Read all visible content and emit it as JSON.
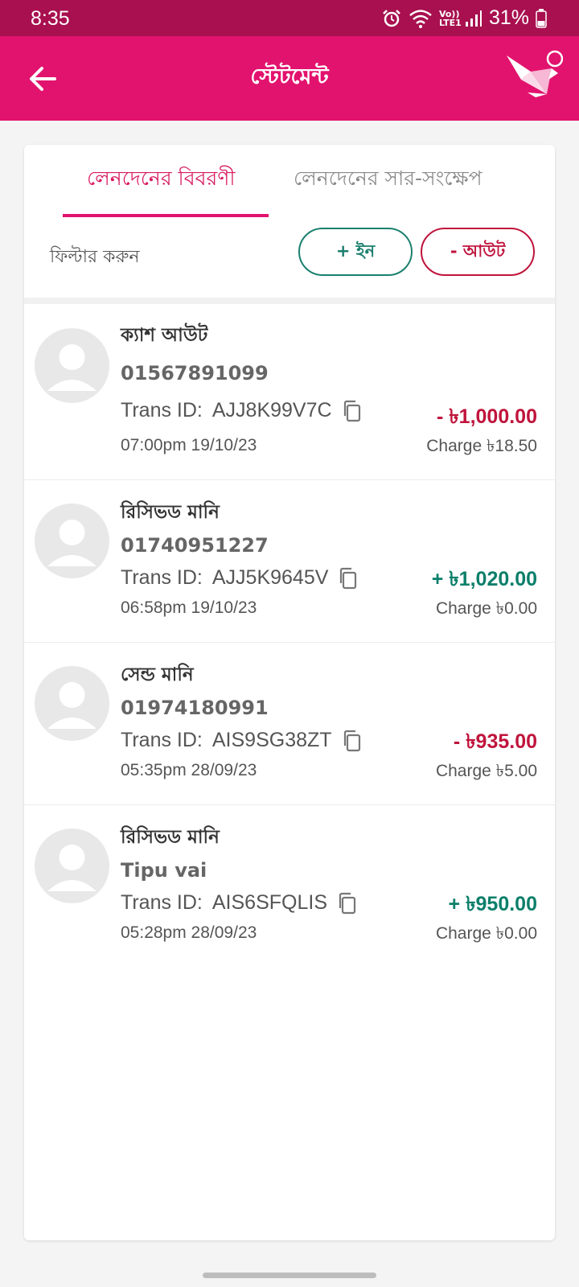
{
  "status_bar": {
    "time": "8:35",
    "network": "Vo)) LTE1",
    "battery": "31%"
  },
  "app_bar": {
    "title": "স্টেটমেন্ট"
  },
  "tabs": [
    {
      "label": "লেনদেনের বিবরণী",
      "active": true
    },
    {
      "label": "লেনদেনের সার-সংক্ষেপ",
      "active": false
    }
  ],
  "filter": {
    "label": "ফিল্টার করুন",
    "in_label": "+  ইন",
    "out_label": "-  আউট"
  },
  "transactions": [
    {
      "type": "ক্যাশ আউট",
      "party": "01567891099",
      "trans_id_label": "Trans ID:",
      "trans_id": "AJJ8K99V7C",
      "time": "07:00pm 19/10/23",
      "amount": "- ৳1,000.00",
      "direction": "out",
      "charge": "Charge ৳18.50"
    },
    {
      "type": "রিসিভড মানি",
      "party": "01740951227",
      "trans_id_label": "Trans ID:",
      "trans_id": "AJJ5K9645V",
      "time": "06:58pm 19/10/23",
      "amount": "+ ৳1,020.00",
      "direction": "in",
      "charge": "Charge ৳0.00"
    },
    {
      "type": "সেন্ড মানি",
      "party": "01974180991",
      "trans_id_label": "Trans ID:",
      "trans_id": "AIS9SG38ZT",
      "time": "05:35pm 28/09/23",
      "amount": "- ৳935.00",
      "direction": "out",
      "charge": "Charge ৳5.00"
    },
    {
      "type": "রিসিভড মানি",
      "party": "Tipu vai",
      "trans_id_label": "Trans ID:",
      "trans_id": "AIS6SFQLIS",
      "time": "05:28pm 28/09/23",
      "amount": "+ ৳950.00",
      "direction": "in",
      "charge": "Charge ৳0.00"
    }
  ],
  "colors": {
    "brand": "#e2136e",
    "status_bar": "#a8104f",
    "out": "#c0143c",
    "in": "#0b7f6a"
  },
  "icons": [
    "back-arrow-icon",
    "bkash-logo-icon",
    "alarm-icon",
    "wifi-icon",
    "signal-icon",
    "battery-icon",
    "copy-icon",
    "avatar-icon"
  ]
}
